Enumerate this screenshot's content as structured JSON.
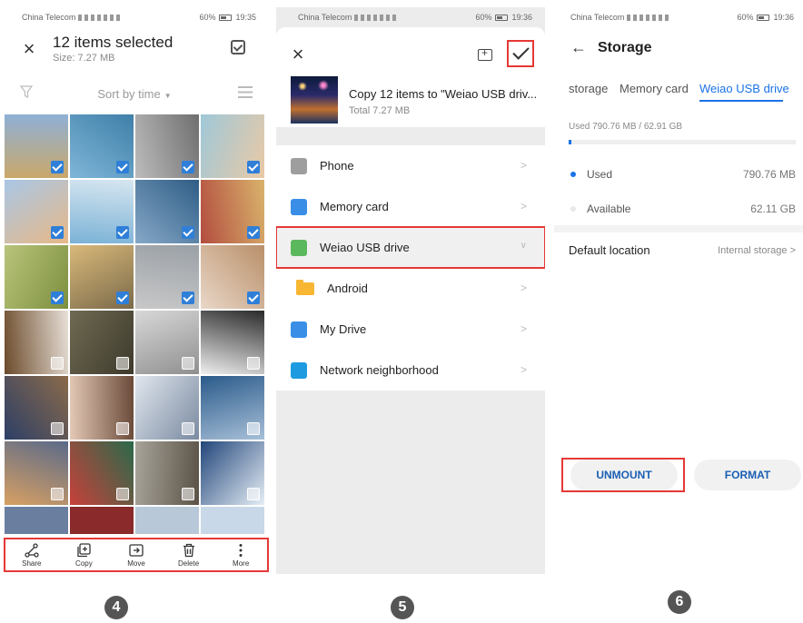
{
  "panel1": {
    "status": {
      "carrier": "China Telecom",
      "battery": "60%",
      "time": "19:35"
    },
    "title": "12 items selected",
    "size": "Size: 7.27 MB",
    "sort": "Sort by time",
    "bottom_actions": [
      {
        "label": "Share",
        "icon": "share-icon"
      },
      {
        "label": "Copy",
        "icon": "copy-icon"
      },
      {
        "label": "Move",
        "icon": "move-icon"
      },
      {
        "label": "Delete",
        "icon": "delete-icon"
      },
      {
        "label": "More",
        "icon": "more-icon"
      }
    ],
    "thumbs_selected": [
      true,
      true,
      true,
      true,
      true,
      true,
      true,
      true,
      true,
      true,
      true,
      true,
      false,
      false,
      false,
      false,
      false,
      false,
      false,
      false,
      false,
      false,
      false,
      false
    ],
    "step": "4"
  },
  "panel2": {
    "status": {
      "carrier": "China Telecom",
      "battery": "60%",
      "time": "19:36"
    },
    "copy_title": "Copy 12 items to \"Weiao USB driv...",
    "copy_total": "Total 7.27 MB",
    "destinations": [
      {
        "label": "Phone",
        "icon": "phone-icon",
        "color": "#9e9e9e"
      },
      {
        "label": "Memory card",
        "icon": "memory-card-icon",
        "color": "#3a8ee6"
      },
      {
        "label": "Weiao USB drive",
        "icon": "usb-icon",
        "color": "#5cb85c"
      },
      {
        "label": "Android",
        "icon": "folder-icon",
        "color": "#f7b733"
      },
      {
        "label": "My Drive",
        "icon": "cloud-icon",
        "color": "#3a8ee6"
      },
      {
        "label": "Network neighborhood",
        "icon": "network-icon",
        "color": "#1e9be0"
      }
    ],
    "step": "5"
  },
  "panel3": {
    "status": {
      "carrier": "China Telecom",
      "battery": "60%",
      "time": "19:36"
    },
    "title": "Storage",
    "tabs": [
      "storage",
      "Memory card",
      "Weiao USB drive"
    ],
    "active_tab": "Weiao USB drive",
    "used_summary": "Used 790.76 MB / 62.91 GB",
    "used_fraction": 0.012,
    "used_label": "Used",
    "used_value": "790.76 MB",
    "available_label": "Available",
    "available_value": "62.11 GB",
    "default_location_label": "Default location",
    "default_location_value": "Internal storage",
    "buttons": {
      "unmount": "UNMOUNT",
      "format": "FORMAT"
    },
    "accent": "#1a73e8",
    "step": "6"
  },
  "highlight_color": "#e53935"
}
